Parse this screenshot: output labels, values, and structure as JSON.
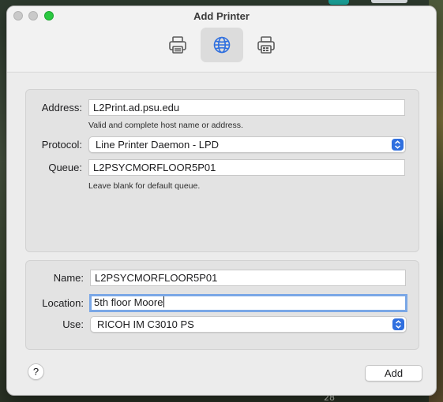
{
  "window": {
    "title": "Add Printer"
  },
  "toolbar": {
    "buttons": [
      {
        "icon": "printer-icon",
        "selected": false
      },
      {
        "icon": "globe-icon",
        "selected": true
      },
      {
        "icon": "printer-doc-icon",
        "selected": false
      }
    ]
  },
  "connection": {
    "address_label": "Address:",
    "address_value": "L2Print.ad.psu.edu",
    "address_hint": "Valid and complete host name or address.",
    "protocol_label": "Protocol:",
    "protocol_value": "Line Printer Daemon - LPD",
    "queue_label": "Queue:",
    "queue_value": "L2PSYCMORFLOOR5P01",
    "queue_hint": "Leave blank for default queue."
  },
  "details": {
    "name_label": "Name:",
    "name_value": "L2PSYCMORFLOOR5P01",
    "location_label": "Location:",
    "location_value": "5th floor Moore",
    "use_label": "Use:",
    "use_value": "RICOH IM C3010 PS"
  },
  "footer": {
    "help_label": "?",
    "add_label": "Add"
  },
  "desktop": {
    "corner_text": "28"
  },
  "colors": {
    "accent": "#2f6fdf",
    "focus_ring": "#7aa7e6",
    "zoom_green": "#2ac840"
  }
}
